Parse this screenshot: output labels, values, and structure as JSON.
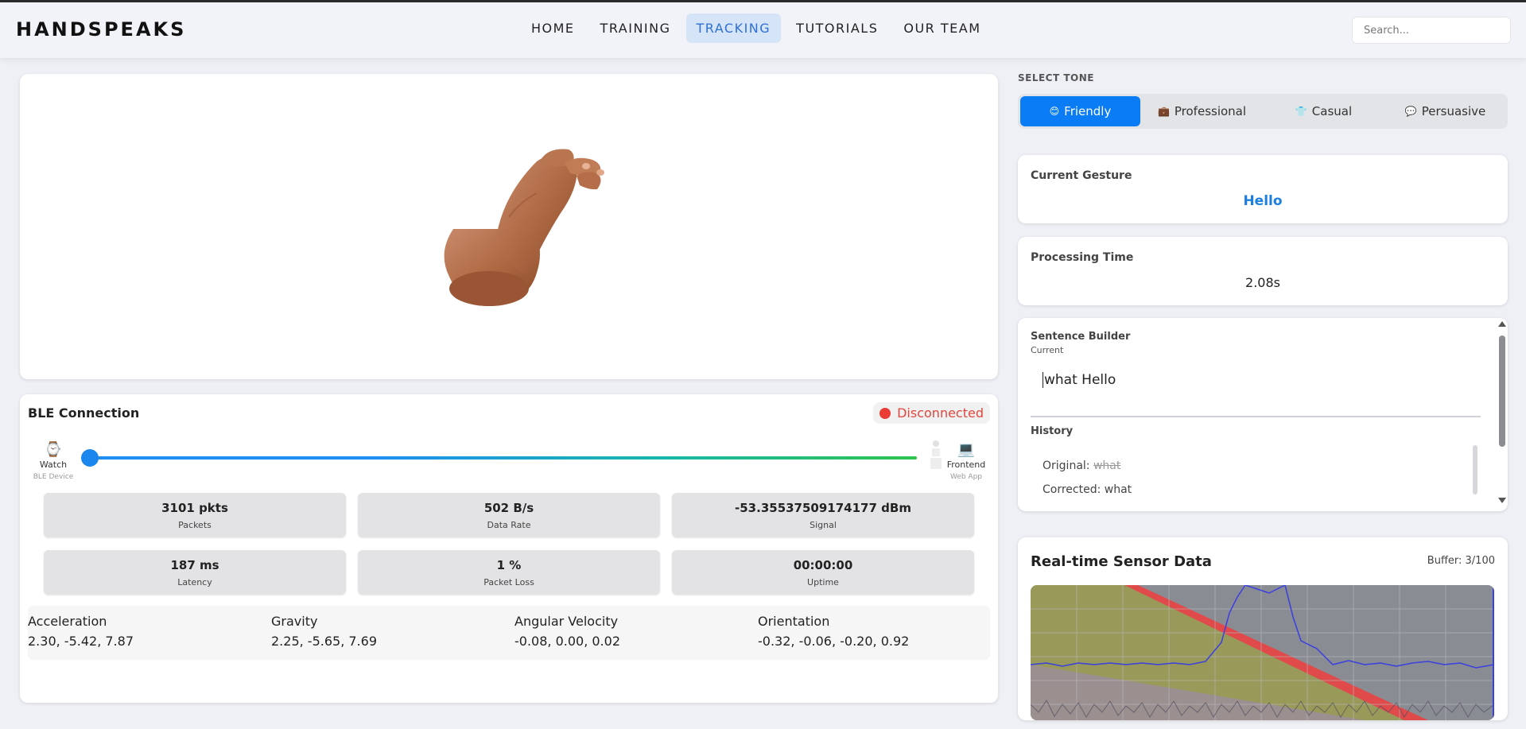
{
  "brand": "HANDSPEAKS",
  "nav": {
    "links": [
      "HOME",
      "TRAINING",
      "TRACKING",
      "TUTORIALS",
      "OUR TEAM"
    ],
    "active": "TRACKING"
  },
  "search": {
    "placeholder": "Search..."
  },
  "ble": {
    "title": "BLE Connection",
    "status": "Disconnected",
    "status_color": "#ea3c35",
    "source": {
      "icon": "watch-icon",
      "label": "Watch",
      "sub": "BLE Device"
    },
    "target": {
      "icon": "laptop-icon",
      "label": "Frontend",
      "sub": "Web App"
    },
    "stats": [
      {
        "value": "3101 pkts",
        "label": "Packets"
      },
      {
        "value": "502 B/s",
        "label": "Data Rate"
      },
      {
        "value": "-53.35537509174177 dBm",
        "label": "Signal"
      },
      {
        "value": "187 ms",
        "label": "Latency"
      },
      {
        "value": "1 %",
        "label": "Packet Loss"
      },
      {
        "value": "00:00:00",
        "label": "Uptime"
      }
    ],
    "sensors": [
      {
        "title": "Acceleration",
        "value": "2.30, -5.42, 7.87"
      },
      {
        "title": "Gravity",
        "value": "2.25, -5.65, 7.69"
      },
      {
        "title": "Angular Velocity",
        "value": "-0.08, 0.00, 0.02"
      },
      {
        "title": "Orientation",
        "value": "-0.32, -0.06, -0.20, 0.92"
      }
    ]
  },
  "tone": {
    "label": "SELECT TONE",
    "options": [
      {
        "icon": "smiley-icon",
        "glyph": "😊",
        "label": "Friendly"
      },
      {
        "icon": "briefcase-icon",
        "glyph": "💼",
        "label": "Professional"
      },
      {
        "icon": "shirt-icon",
        "glyph": "👕",
        "label": "Casual"
      },
      {
        "icon": "speech-bubble-icon",
        "glyph": "💬",
        "label": "Persuasive"
      }
    ],
    "active": "Friendly",
    "accent": "#0a7cf5"
  },
  "gesture": {
    "title": "Current Gesture",
    "value": "Hello"
  },
  "processing": {
    "title": "Processing Time",
    "value": "2.08s"
  },
  "builder": {
    "title": "Sentence Builder",
    "current_label": "Current",
    "current_text": "what Hello",
    "history_label": "History",
    "original_label": "Original:",
    "original_text": "what",
    "corrected_label": "Corrected:",
    "corrected_text": "what"
  },
  "sensor_card": {
    "title": "Real-time Sensor Data",
    "buffer": "Buffer: 3/100"
  }
}
